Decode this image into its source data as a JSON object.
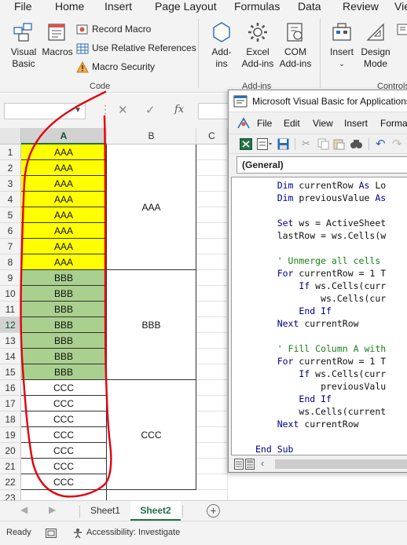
{
  "menu": {
    "tabs": [
      "File",
      "Home",
      "Insert",
      "Page Layout",
      "Formulas",
      "Data",
      "Review",
      "Vie"
    ]
  },
  "ribbon": {
    "visual_basic": "Visual Basic",
    "macros": "Macros",
    "record_macro": "Record Macro",
    "relative_refs": "Use Relative References",
    "macro_security": "Macro Security",
    "group_code": "Code",
    "add_ins": "Add-ins",
    "excel_add_ins": "Excel Add-ins",
    "com_add_ins": "COM Add-ins",
    "group_add_ins": "Add-ins",
    "insert": "Insert",
    "design_mode": "Design Mode",
    "group_controls": "Controls"
  },
  "formula_bar": {
    "fx": "fx",
    "name_box": "",
    "value": ""
  },
  "grid": {
    "columns": [
      "A",
      "B",
      "C"
    ],
    "rows": [
      {
        "n": "1",
        "a": "AAA"
      },
      {
        "n": "2",
        "a": "AAA"
      },
      {
        "n": "3",
        "a": "AAA"
      },
      {
        "n": "4",
        "a": "AAA"
      },
      {
        "n": "5",
        "a": "AAA"
      },
      {
        "n": "6",
        "a": "AAA"
      },
      {
        "n": "7",
        "a": "AAA"
      },
      {
        "n": "8",
        "a": "AAA"
      },
      {
        "n": "9",
        "a": "BBB"
      },
      {
        "n": "10",
        "a": "BBB"
      },
      {
        "n": "11",
        "a": "BBB"
      },
      {
        "n": "12",
        "a": "BBB"
      },
      {
        "n": "13",
        "a": "BBB"
      },
      {
        "n": "14",
        "a": "BBB"
      },
      {
        "n": "15",
        "a": "BBB"
      },
      {
        "n": "16",
        "a": "CCC"
      },
      {
        "n": "17",
        "a": "CCC"
      },
      {
        "n": "18",
        "a": "CCC"
      },
      {
        "n": "19",
        "a": "CCC"
      },
      {
        "n": "20",
        "a": "CCC"
      },
      {
        "n": "21",
        "a": "CCC"
      },
      {
        "n": "22",
        "a": "CCC"
      },
      {
        "n": "23",
        "a": ""
      }
    ],
    "merged_b": [
      "AAA",
      "BBB",
      "CCC"
    ],
    "colors": {
      "group_aaa": "#ffff00",
      "group_bbb": "#a9d08e",
      "group_ccc": "#ffffff"
    }
  },
  "sheets": {
    "tabs": [
      "Sheet1",
      "Sheet2"
    ],
    "active": "Sheet2"
  },
  "status": {
    "ready": "Ready",
    "accessibility": "Accessibility: Investigate"
  },
  "vba": {
    "title": "Microsoft Visual Basic for Applications",
    "menu": [
      "File",
      "Edit",
      "View",
      "Insert",
      "Format"
    ],
    "combo": "(General)",
    "code": [
      {
        "text": "    Dim currentRow As Lo",
        "kind": "dim"
      },
      {
        "text": "    Dim previousValue As",
        "kind": "dim"
      },
      {
        "text": "",
        "kind": "plain"
      },
      {
        "text": "    Set ws = ActiveSheet",
        "kind": "set"
      },
      {
        "text": "    lastRow = ws.Cells(w",
        "kind": "plain"
      },
      {
        "text": "",
        "kind": "plain"
      },
      {
        "text": "    ' Unmerge all cells",
        "kind": "comment"
      },
      {
        "text": "    For currentRow = 1 T",
        "kind": "for"
      },
      {
        "text": "        If ws.Cells(curr",
        "kind": "if"
      },
      {
        "text": "            ws.Cells(cur",
        "kind": "plain"
      },
      {
        "text": "        End If",
        "kind": "endif"
      },
      {
        "text": "    Next currentRow",
        "kind": "next"
      },
      {
        "text": "",
        "kind": "plain"
      },
      {
        "text": "    ' Fill Column A with",
        "kind": "comment"
      },
      {
        "text": "    For currentRow = 1 T",
        "kind": "for"
      },
      {
        "text": "        If ws.Cells(curr",
        "kind": "if"
      },
      {
        "text": "            previousValu",
        "kind": "plain"
      },
      {
        "text": "        End If",
        "kind": "endif"
      },
      {
        "text": "        ws.Cells(current",
        "kind": "plain"
      },
      {
        "text": "    Next currentRow",
        "kind": "next"
      },
      {
        "text": "",
        "kind": "plain"
      },
      {
        "text": "End Sub",
        "kind": "endsub"
      }
    ]
  }
}
